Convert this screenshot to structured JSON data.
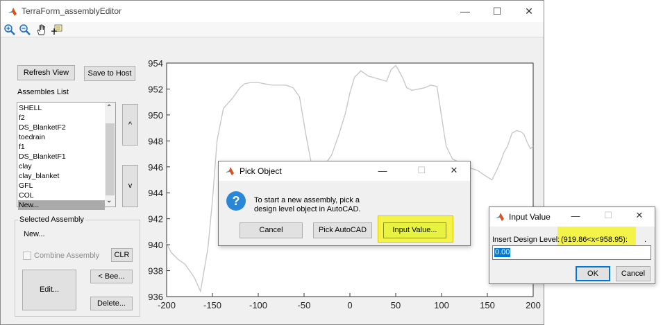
{
  "main_window": {
    "title": "TerraForm_assemblyEditor",
    "controls": {
      "minimize": "—",
      "maximize": "☐",
      "close": "✕"
    },
    "toolbar": {
      "icons": [
        "zoom-in-icon",
        "zoom-out-icon",
        "pan-icon",
        "data-cursor-icon"
      ]
    },
    "buttons": {
      "refresh_view": "Refresh View",
      "save_to_host": "Save to Host",
      "up": "^",
      "down": "v",
      "clr": "CLR",
      "bee": "< Bee...",
      "edit": "Edit...",
      "delete": "Delete..."
    },
    "assemblies_label": "Assembles List",
    "assemblies": [
      "SHELL",
      "f2",
      "DS_BlanketF2",
      "toedrain",
      "f1",
      "DS_BlanketF1",
      "clay",
      "clay_blanket",
      "GFL",
      "COL",
      "New..."
    ],
    "selected_index": 10,
    "selected_assembly": {
      "title": "Selected Assembly",
      "value": "New...",
      "combine_label": "Combine Assembly",
      "combine_checked": false
    }
  },
  "chart_data": {
    "type": "line",
    "title": "",
    "xlabel": "",
    "ylabel": "",
    "xlim": [
      -200,
      200
    ],
    "ylim": [
      936,
      954
    ],
    "x_ticks": [
      -200,
      -150,
      -100,
      -50,
      0,
      50,
      100,
      150,
      200
    ],
    "y_ticks": [
      936,
      938,
      940,
      942,
      944,
      946,
      948,
      950,
      952,
      954
    ],
    "grid": false,
    "series": [
      {
        "color": "#c8c8c8",
        "x": [
          -200,
          -195,
          -188,
          -180,
          -170,
          -163,
          -155,
          -150,
          -145,
          -138,
          -128,
          -120,
          -115,
          -108,
          -100,
          -93,
          -85,
          -78,
          -70,
          -62,
          -55,
          -48,
          -42,
          -38,
          -35,
          -32,
          -30,
          -26,
          -20,
          -12,
          -5,
          0,
          5,
          12,
          20,
          30,
          40,
          45,
          50,
          52,
          55,
          58,
          62,
          68,
          75,
          82,
          88,
          95,
          100,
          105,
          112,
          118,
          125,
          132,
          140,
          148,
          155,
          160,
          165,
          168,
          172,
          177,
          182,
          187,
          190,
          194,
          197,
          200
        ],
        "y": [
          940.1,
          939.4,
          938.9,
          938.5,
          937.5,
          936.4,
          939.7,
          943.4,
          948.0,
          950.5,
          951.3,
          952.1,
          952.4,
          952.5,
          952.5,
          952.4,
          952.3,
          952.3,
          952.3,
          952.1,
          951.4,
          948.5,
          946.2,
          944.7,
          944.3,
          944.3,
          944.3,
          946.3,
          946.9,
          948.5,
          950.1,
          951.7,
          952.9,
          953.4,
          953.0,
          952.8,
          952.6,
          953.5,
          953.8,
          953.6,
          953.2,
          952.8,
          952.1,
          951.9,
          952.0,
          952.1,
          952.3,
          952.2,
          949.9,
          947.6,
          946.6,
          946.4,
          946.2,
          945.9,
          945.7,
          945.3,
          945.0,
          945.7,
          946.5,
          947.1,
          947.6,
          948.6,
          948.8,
          948.7,
          948.5,
          947.8,
          947.4,
          947.6
        ]
      }
    ]
  },
  "pick_dialog": {
    "title": "Pick Object",
    "message_line1": "To start a new assembly, pick a",
    "message_line2": "design level object in AutoCAD.",
    "buttons": {
      "cancel": "Cancel",
      "pick_autocad": "Pick AutoCAD",
      "input_value": "Input Value..."
    },
    "highlight_color": "#f3f34a"
  },
  "input_dialog": {
    "title": "Input Value",
    "prompt_prefix": "Insert Design Level:",
    "prompt_range": "(919.86<x<958.95):",
    "prompt_dot": ".",
    "value": "0.00",
    "buttons": {
      "ok": "OK",
      "cancel": "Cancel"
    },
    "highlight_color": "#f3f34a"
  }
}
